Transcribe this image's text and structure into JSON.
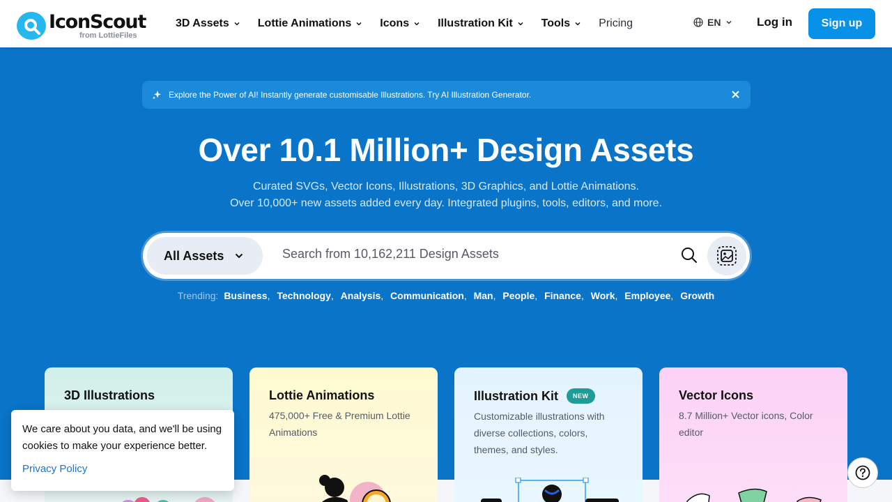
{
  "header": {
    "logo_name": "IconScout",
    "logo_sub": "from LottieFiles",
    "nav": [
      {
        "label": "3D Assets"
      },
      {
        "label": "Lottie Animations"
      },
      {
        "label": "Icons"
      },
      {
        "label": "Illustration Kit"
      },
      {
        "label": "Tools"
      }
    ],
    "pricing_label": "Pricing",
    "language": "EN",
    "login_label": "Log in",
    "signup_label": "Sign up"
  },
  "promo": {
    "text": "Explore the Power of AI! Instantly generate customisable Illustrations. Try AI Illustration Generator."
  },
  "hero": {
    "title": "Over 10.1 Million+ Design Assets",
    "subtitle_line1": "Curated SVGs, Vector Icons, Illustrations, 3D Graphics, and Lottie Animations.",
    "subtitle_line2": "Over 10,000+ new assets added every day. Integrated plugins, tools, editors, and more."
  },
  "search": {
    "category": "All Assets",
    "placeholder": "Search from 10,162,211 Design Assets"
  },
  "trending": {
    "label": "Trending:",
    "tags": [
      "Business",
      "Technology",
      "Analysis",
      "Communication",
      "Man",
      "People",
      "Finance",
      "Work",
      "Employee",
      "Growth"
    ]
  },
  "cards": [
    {
      "title": "3D Illustrations",
      "desc": ""
    },
    {
      "title": "Lottie Animations",
      "desc": "475,000+ Free & Premium Lottie Animations"
    },
    {
      "title": "Illustration Kit",
      "badge": "NEW",
      "desc": "Customizable illustrations with diverse collections, colors, themes, and styles."
    },
    {
      "title": "Vector Icons",
      "desc": "8.7 Million+ Vector icons, Color editor"
    }
  ],
  "cookie": {
    "text": "We care about you data, and we'll be using cookies to make your experience better.",
    "link": "Privacy Policy"
  },
  "colors": {
    "hero_bg": "#0a74c9",
    "primary_button": "#0792e8",
    "badge": "#1c9d97"
  }
}
